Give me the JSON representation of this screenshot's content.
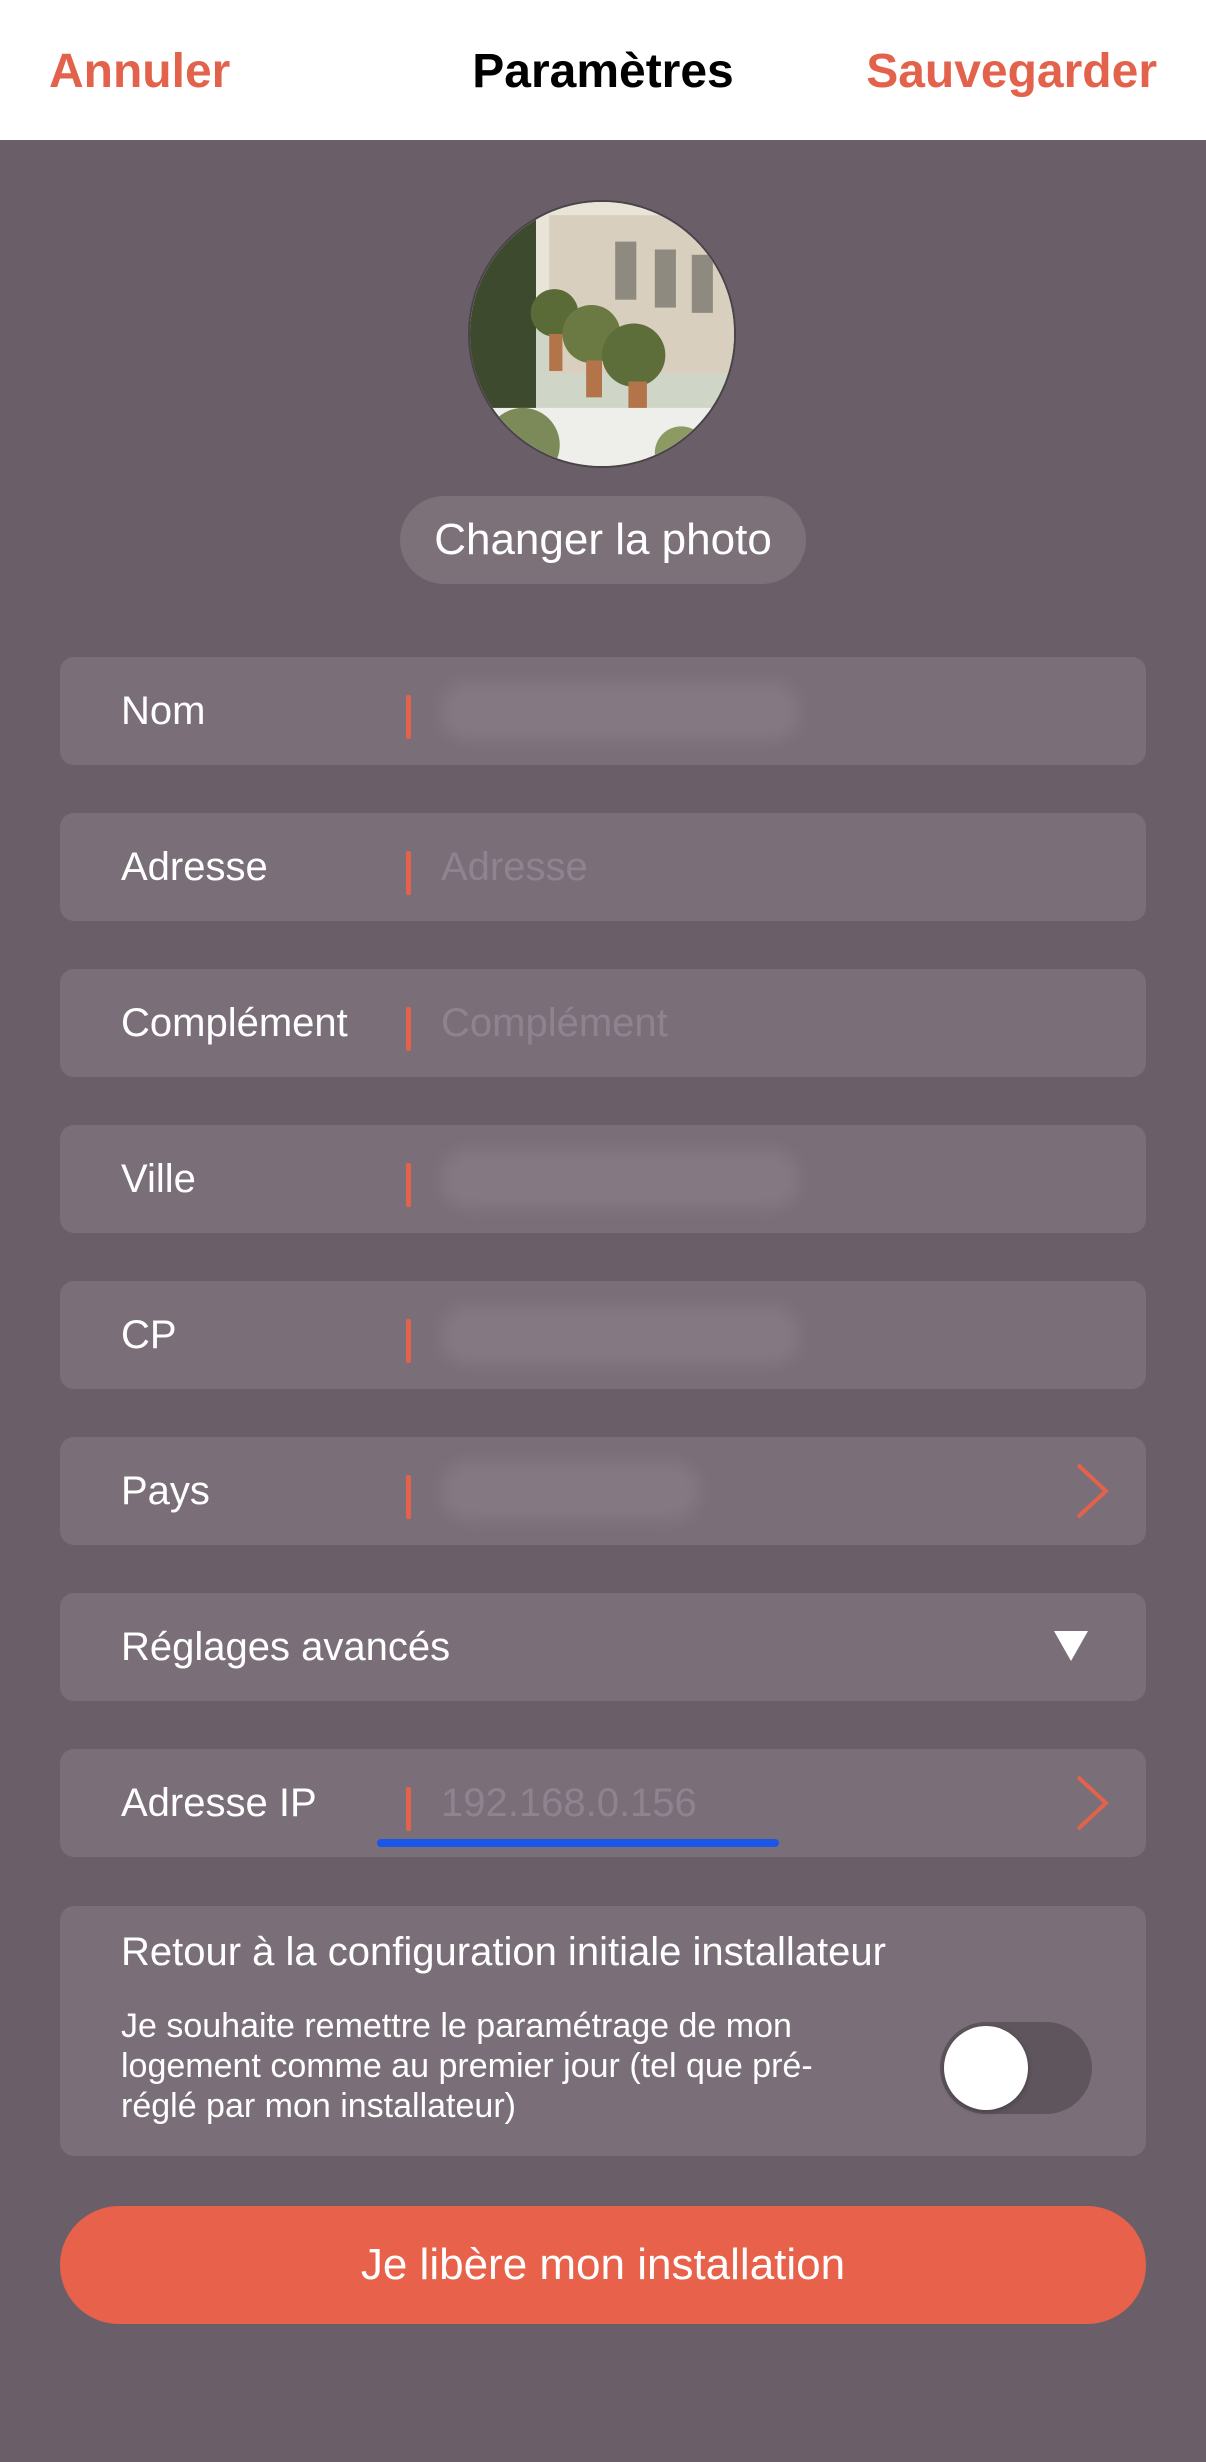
{
  "header": {
    "cancel_label": "Annuler",
    "title": "Paramètres",
    "save_label": "Sauvegarder"
  },
  "photo": {
    "change_label": "Changer la photo"
  },
  "fields": {
    "nom": {
      "label": "Nom",
      "value": ""
    },
    "adresse": {
      "label": "Adresse",
      "placeholder": "Adresse"
    },
    "complement": {
      "label": "Complément",
      "placeholder": "Complément"
    },
    "ville": {
      "label": "Ville",
      "value": ""
    },
    "cp": {
      "label": "CP",
      "value": ""
    },
    "pays": {
      "label": "Pays",
      "value": "",
      "icon": "chevron-right-icon"
    },
    "reglages": {
      "label": "Réglages avancés",
      "icon": "triangle-down-icon"
    },
    "ip": {
      "label": "Adresse IP",
      "value": "192.168.0.156",
      "icon": "chevron-right-icon"
    }
  },
  "reset": {
    "title": "Retour à la configuration initiale installateur",
    "description": "Je souhaite remettre le paramétrage de mon logement comme au premier jour (tel que pré-réglé par mon installateur)",
    "toggle_on": false
  },
  "cta": {
    "label": "Je libère mon installation"
  },
  "colors": {
    "accent": "#e2624b",
    "background": "#6a5f68",
    "field": "#7a6f78",
    "underline": "#1a56e8"
  }
}
